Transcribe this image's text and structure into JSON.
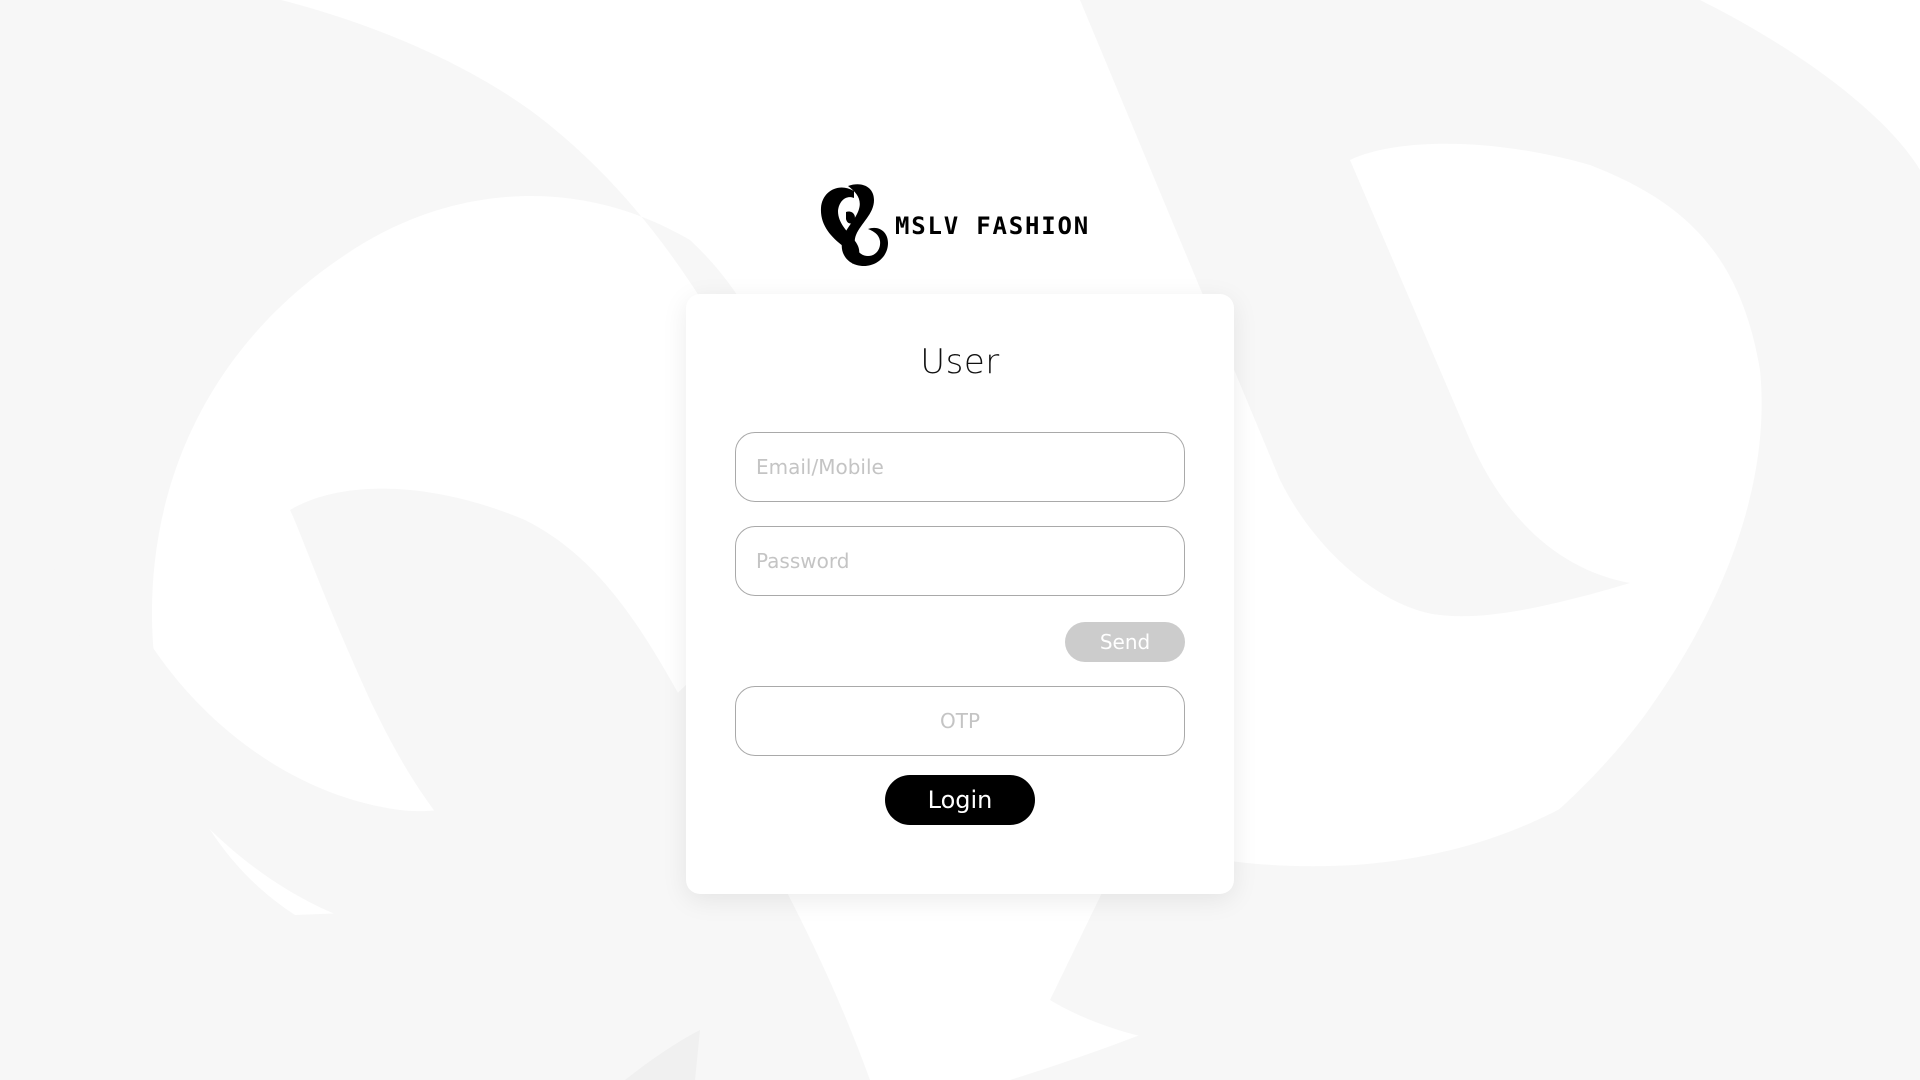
{
  "brand": {
    "wordmark": "MSLV FASHION",
    "logo_icon": "mslv-logo-icon"
  },
  "login_card": {
    "title": "User",
    "email_placeholder": "Email/Mobile",
    "password_placeholder": "Password",
    "send_label": "Send",
    "otp_placeholder": "OTP",
    "login_label": "Login"
  },
  "colors": {
    "background": "#ffffff",
    "background_art": "#f7f7f7",
    "primary_button": "#000000",
    "disabled_button": "#cccccc",
    "field_border": "#a9a9a9"
  }
}
